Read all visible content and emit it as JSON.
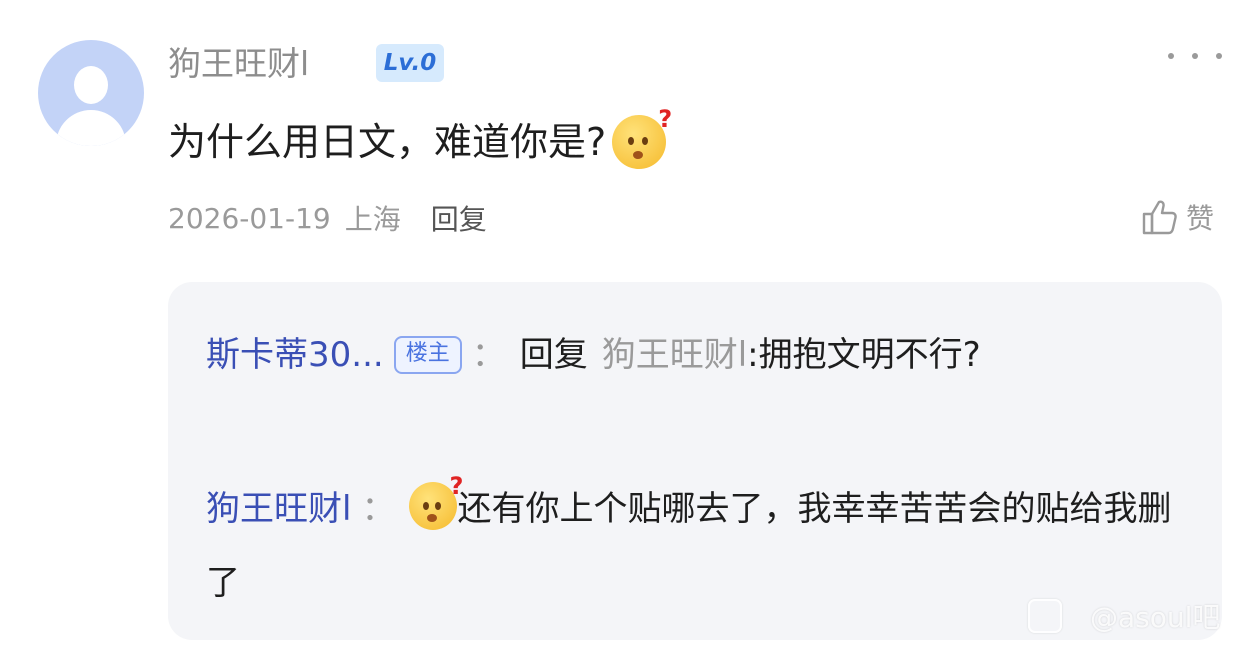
{
  "comment": {
    "author": "狗王旺财l",
    "level_badge": "Lv.0",
    "text": "为什么用日文，难道你是?",
    "date": "2026-01-19",
    "location": "上海",
    "reply_label": "回复",
    "like_label": "赞"
  },
  "replies": [
    {
      "author": "斯卡蒂30...",
      "badge": "楼主",
      "separator": "：",
      "reply_word": "回复",
      "reply_to": "狗王旺财l",
      "text": ":拥抱文明不行?"
    },
    {
      "author": "狗王旺财l",
      "separator": "：",
      "text": "还有你上个贴哪去了，我幸幸苦苦会的贴给我删了"
    }
  ],
  "icons": {
    "more": "more-dots-icon",
    "like": "thumb-up-icon",
    "emoji": "confused-face-emoji-icon"
  },
  "colors": {
    "author_link": "#3a4fb5",
    "level_badge_bg": "#d6eafd",
    "reply_box_bg": "#f4f5f8"
  },
  "watermark": {
    "text": "@asoul吧"
  }
}
